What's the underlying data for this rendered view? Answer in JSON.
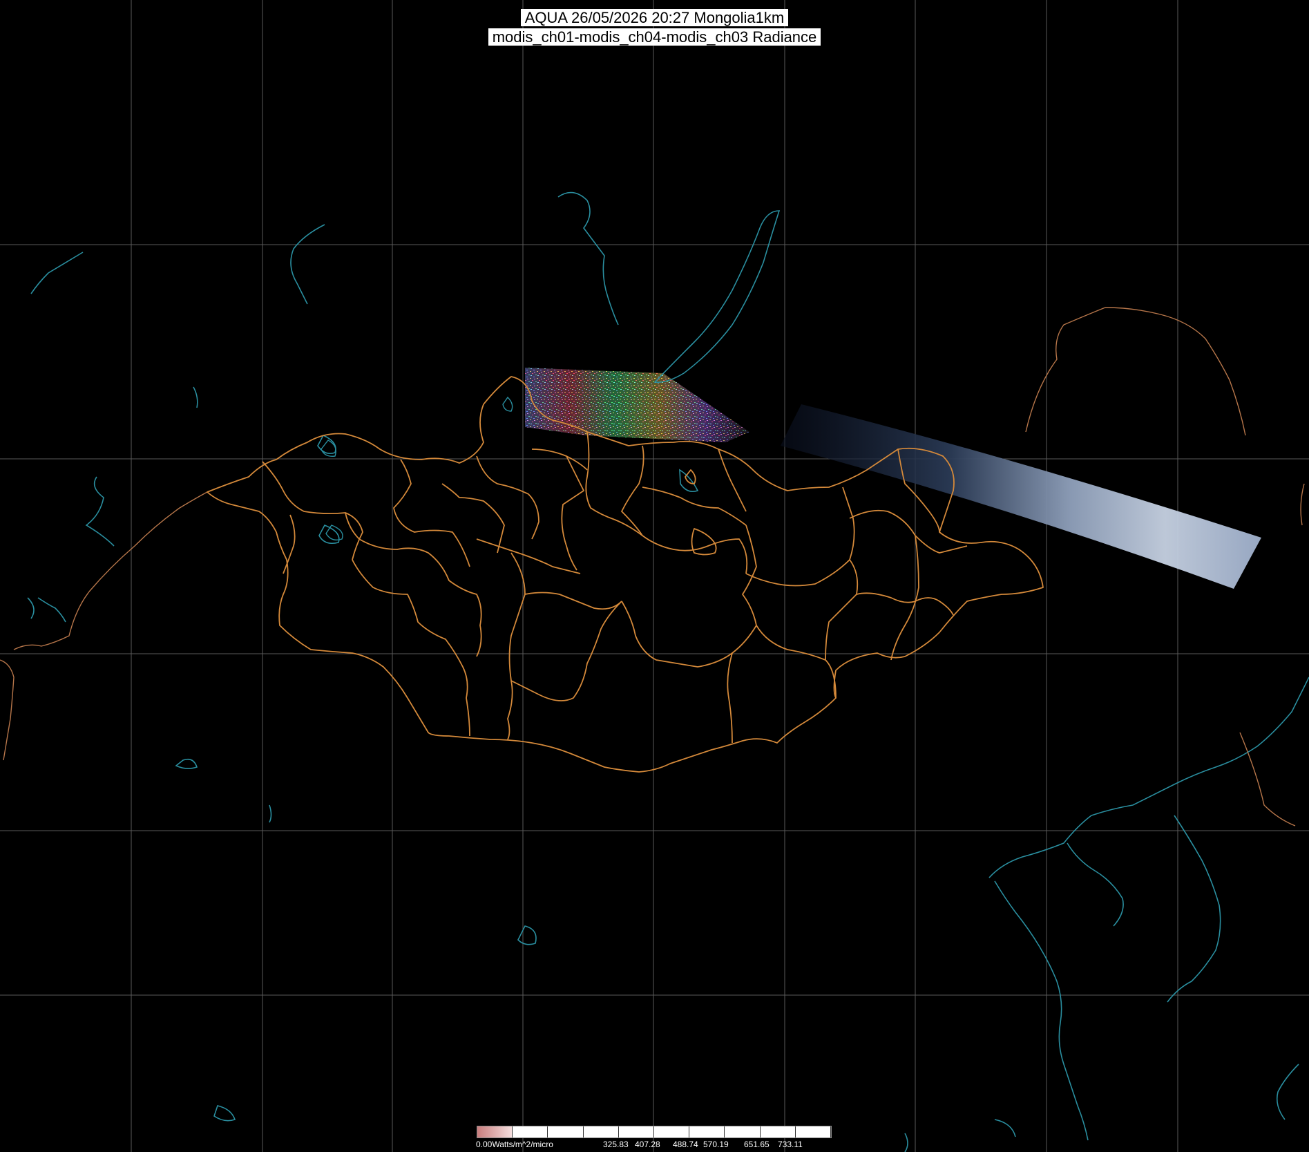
{
  "title": {
    "line1": "AQUA 26/05/2026 20:27 Mongolia1km",
    "line2": "modis_ch01-modis_ch04-modis_ch03 Radiance"
  },
  "legend": {
    "unit_label": "0.00Watts/m^2/micro",
    "tick_labels": [
      "325.83",
      "407.28",
      "488.74",
      "570.19",
      "651.65",
      "733.11"
    ],
    "gradient_start_color": "#c97d7d",
    "gradient_end_color": "#ffffff"
  },
  "colors": {
    "background": "#000000",
    "graticule": "#5a5a5a",
    "province_borders": "#d4893a",
    "coastlines_and_lakes": "#2a8fa0",
    "swath_clouds": "#c8d4e6",
    "swath_dark": "#1a2a45"
  }
}
